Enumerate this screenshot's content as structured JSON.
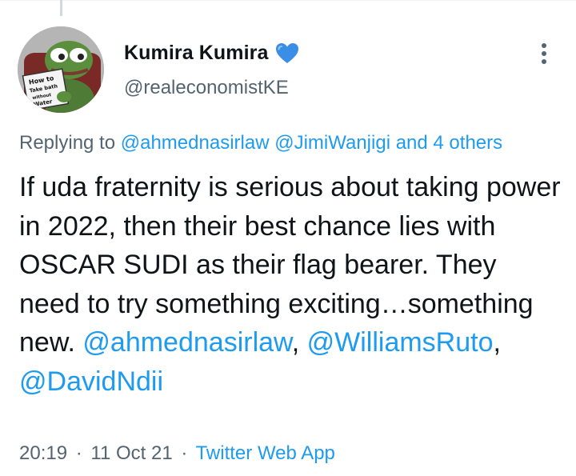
{
  "tweet": {
    "author": {
      "display_name": "Kumira Kumira",
      "handle": "@realeconomistKE",
      "badge_icon": "blue-heart-icon",
      "avatar_sign_text": "How to Take bath without Water"
    },
    "replying_to": {
      "prefix": "Replying to",
      "mention_1": "@ahmednasirlaw",
      "mention_2": "@JimiWanjigi",
      "others": "and 4 others"
    },
    "body": {
      "text": "If uda fraternity is serious about taking power in 2022, then their best chance lies with OSCAR SUDI as their flag bearer. They need to try something exciting…something new.",
      "mention_1": "@ahmednasirlaw",
      "separator_1": ", ",
      "mention_2": "@WilliamsRuto",
      "separator_2": ",",
      "mention_3": "@DavidNdii"
    },
    "meta": {
      "time": "20:19",
      "date": "11 Oct 21",
      "separator": "·",
      "source": "Twitter Web App"
    },
    "colors": {
      "link": "#1d9bf0",
      "secondary_text": "#536471",
      "primary_text": "#0f1419"
    }
  }
}
